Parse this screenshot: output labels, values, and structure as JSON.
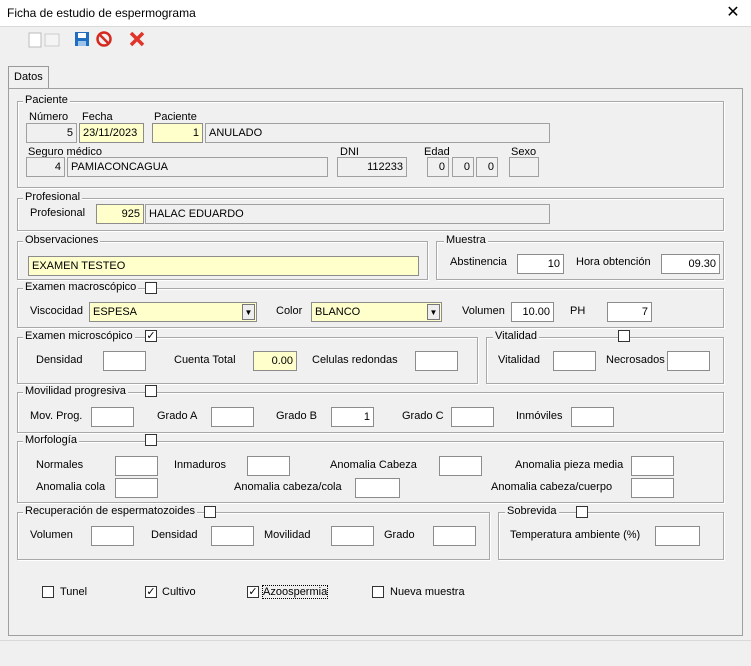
{
  "window": {
    "title": "Ficha de estudio de espermograma",
    "close_glyph": "✕"
  },
  "tabs": {
    "datos": "Datos"
  },
  "paciente": {
    "group_label": "Paciente",
    "numero_label": "Número",
    "numero": "5",
    "fecha_label": "Fecha",
    "fecha": "23/11/2023",
    "paciente_label": "Paciente",
    "paciente_id": "1",
    "paciente_nombre": "ANULADO",
    "seguro_label": "Seguro médico",
    "seguro_id": "4",
    "seguro_nombre": "PAMIACONCAGUA",
    "dni_label": "DNI",
    "dni": "112233",
    "edad_label": "Edad",
    "edad": [
      "0",
      "0",
      "0"
    ],
    "sexo_label": "Sexo",
    "sexo": ""
  },
  "profesional": {
    "group_label": "Profesional",
    "label": "Profesional",
    "id": "925",
    "nombre": "HALAC EDUARDO"
  },
  "observaciones": {
    "group_label": "Observaciones",
    "value": "EXAMEN TESTEO"
  },
  "muestra": {
    "group_label": "Muestra",
    "abstinencia_label": "Abstinencia",
    "abstinencia": "10",
    "hora_label": "Hora obtención",
    "hora": "09.30"
  },
  "macro": {
    "group_label": "Examen macroscópico",
    "checked": false,
    "viscosidad_label": "Viscocidad",
    "viscosidad": "ESPESA",
    "color_label": "Color",
    "color": "BLANCO",
    "volumen_label": "Volumen",
    "volumen": "10.00",
    "ph_label": "PH",
    "ph": "7"
  },
  "micro": {
    "group_label": "Examen microscópico",
    "checked": true,
    "densidad_label": "Densidad",
    "densidad": "",
    "cuenta_label": "Cuenta Total",
    "cuenta": "0.00",
    "celulas_label": "Celulas redondas",
    "celulas": ""
  },
  "vitalidad": {
    "group_label": "Vitalidad",
    "checked": false,
    "vitalidad_label": "Vitalidad",
    "vitalidad": "",
    "necrosados_label": "Necrosados",
    "necrosados": ""
  },
  "movilidad": {
    "group_label": "Movilidad progresiva",
    "checked": false,
    "mov_label": "Mov. Prog.",
    "mov": "",
    "a_label": "Grado A",
    "a": "",
    "b_label": "Grado B",
    "b": "1",
    "c_label": "Grado C",
    "c": "",
    "inm_label": "Inmóviles",
    "inm": ""
  },
  "morfologia": {
    "group_label": "Morfología",
    "checked": false,
    "normales_label": "Normales",
    "inmaduros_label": "Inmaduros",
    "cabeza_label": "Anomalia Cabeza",
    "pieza_label": "Anomalia pieza media",
    "cola_label": "Anomalia cola",
    "cabcola_label": "Anomalia cabeza/cola",
    "cabcuerpo_label": "Anomalia cabeza/cuerpo"
  },
  "recuperacion": {
    "group_label": "Recuperación de espermatozoides",
    "checked": false,
    "volumen_label": "Volumen",
    "densidad_label": "Densidad",
    "movilidad_label": "Movilidad",
    "grado_label": "Grado"
  },
  "sobrevida": {
    "group_label": "Sobrevida",
    "checked": false,
    "temp_label": "Temperatura ambiente (%)"
  },
  "checks": {
    "tunel": "Tunel",
    "tunel_checked": false,
    "cultivo": "Cultivo",
    "cultivo_checked": true,
    "azoo": "Azoospermia",
    "azoo_checked": true,
    "nueva": "Nueva muestra",
    "nueva_checked": false
  },
  "icons": {
    "new": "new-document-icon",
    "save": "save-icon",
    "cancel": "cancel-icon",
    "delete": "delete-icon",
    "colors": {
      "save": "#1e6fc2",
      "cancel": "#d42a1f",
      "delete": "#e0342a",
      "field_yellow": "#ffffcc"
    }
  }
}
